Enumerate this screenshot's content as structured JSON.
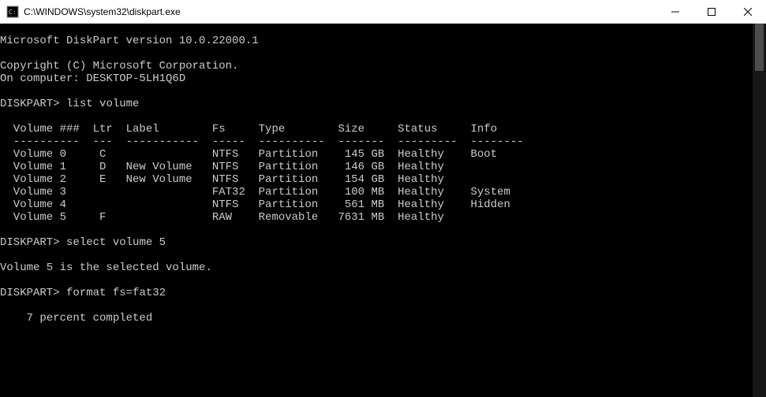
{
  "window": {
    "title": "C:\\WINDOWS\\system32\\diskpart.exe"
  },
  "header": {
    "version_line": "Microsoft DiskPart version 10.0.22000.1",
    "copyright_line": "Copyright (C) Microsoft Corporation.",
    "computer_line": "On computer: DESKTOP-5LH1Q6D"
  },
  "prompt": "DISKPART>",
  "commands": {
    "list_volume": "list volume",
    "select_volume": "select volume 5",
    "format": "format fs=fat32"
  },
  "table": {
    "header": "  Volume ###  Ltr  Label        Fs     Type        Size     Status     Info",
    "divider": "  ----------  ---  -----------  -----  ----------  -------  ---------  --------",
    "rows": [
      "  Volume 0     C                NTFS   Partition    145 GB  Healthy    Boot",
      "  Volume 1     D   New Volume   NTFS   Partition    146 GB  Healthy",
      "  Volume 2     E   New Volume   NTFS   Partition    154 GB  Healthy",
      "  Volume 3                      FAT32  Partition    100 MB  Healthy    System",
      "  Volume 4                      NTFS   Partition    561 MB  Healthy    Hidden",
      "  Volume 5     F                RAW    Removable   7631 MB  Healthy"
    ]
  },
  "messages": {
    "selected": "Volume 5 is the selected volume.",
    "progress": "    7 percent completed"
  },
  "volumes_structured": [
    {
      "num": 0,
      "ltr": "C",
      "label": "",
      "fs": "NTFS",
      "type": "Partition",
      "size": "145 GB",
      "status": "Healthy",
      "info": "Boot"
    },
    {
      "num": 1,
      "ltr": "D",
      "label": "New Volume",
      "fs": "NTFS",
      "type": "Partition",
      "size": "146 GB",
      "status": "Healthy",
      "info": ""
    },
    {
      "num": 2,
      "ltr": "E",
      "label": "New Volume",
      "fs": "NTFS",
      "type": "Partition",
      "size": "154 GB",
      "status": "Healthy",
      "info": ""
    },
    {
      "num": 3,
      "ltr": "",
      "label": "",
      "fs": "FAT32",
      "type": "Partition",
      "size": "100 MB",
      "status": "Healthy",
      "info": "System"
    },
    {
      "num": 4,
      "ltr": "",
      "label": "",
      "fs": "NTFS",
      "type": "Partition",
      "size": "561 MB",
      "status": "Healthy",
      "info": "Hidden"
    },
    {
      "num": 5,
      "ltr": "F",
      "label": "",
      "fs": "RAW",
      "type": "Removable",
      "size": "7631 MB",
      "status": "Healthy",
      "info": ""
    }
  ]
}
